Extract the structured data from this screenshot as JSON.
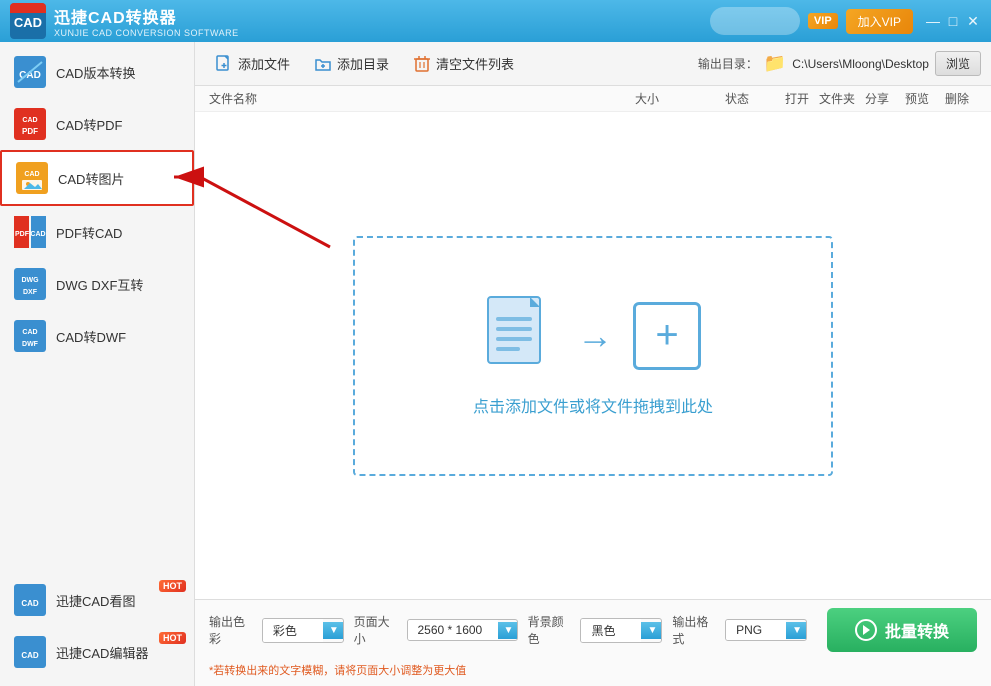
{
  "app": {
    "name": "迅捷CAD转换器",
    "name_en": "XUNJIE CAD CONVERSION SOFTWARE",
    "logo_text": "CAD"
  },
  "titlebar": {
    "vip_label": "VIP",
    "join_vip": "加入VIP",
    "minimize": "—",
    "maximize": "□",
    "close": "✕"
  },
  "sidebar": {
    "items": [
      {
        "id": "cad-version",
        "label": "CAD版本转换",
        "hot": false
      },
      {
        "id": "cad-pdf",
        "label": "CAD转PDF",
        "hot": false
      },
      {
        "id": "cad-img",
        "label": "CAD转图片",
        "hot": false,
        "active": true
      },
      {
        "id": "pdf-cad",
        "label": "PDF转CAD",
        "hot": false
      },
      {
        "id": "dwg-dxf",
        "label": "DWG DXF互转",
        "hot": false
      },
      {
        "id": "cad-dwf",
        "label": "CAD转DWF",
        "hot": false
      }
    ],
    "bottom_items": [
      {
        "id": "cad-viewer",
        "label": "迅捷CAD看图",
        "hot": true
      },
      {
        "id": "cad-editor",
        "label": "迅捷CAD编辑器",
        "hot": true
      }
    ]
  },
  "toolbar": {
    "add_file": "添加文件",
    "add_folder": "添加目录",
    "clear_list": "清空文件列表",
    "output_dir_label": "输出目录：",
    "output_dir_path": "C:\\Users\\Mloong\\Desktop",
    "browse": "浏览"
  },
  "table": {
    "col_name": "文件名称",
    "col_size": "大小",
    "col_status": "状态",
    "col_open": "打开",
    "col_folder": "文件夹",
    "col_share": "分享",
    "col_preview": "预览",
    "col_delete": "删除"
  },
  "dropzone": {
    "text": "点击添加文件或将文件拖拽到此处"
  },
  "bottombar": {
    "color_label": "输出色彩",
    "color_value": "彩色",
    "page_size_label": "页面大小",
    "page_size_value": "2560 * 1600",
    "bg_color_label": "背景颜色",
    "bg_color_value": "黑色",
    "format_label": "输出格式",
    "format_value": "PNG",
    "note": "*若转换出来的文字模糊，请将页面大小调整为更大值",
    "convert_btn": "批量转换"
  }
}
